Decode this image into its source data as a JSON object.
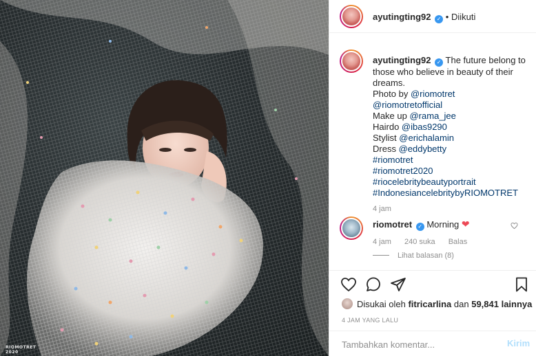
{
  "post": {
    "photo_credit_line1": "RIOMOTRET",
    "photo_credit_line2": "2020"
  },
  "header": {
    "username": "ayutingting92",
    "separator": "•",
    "follow_status": "Diikuti"
  },
  "caption": {
    "username": "ayutingting92",
    "intro": "The future belong to those who believe in beauty of their dreams.",
    "lines": [
      {
        "label": "Photo by ",
        "tag": "@riomotret"
      },
      {
        "label": "",
        "tag": "@riomotretofficial"
      },
      {
        "label": "Make up ",
        "tag": "@rama_jee"
      },
      {
        "label": "Hairdo ",
        "tag": "@ibas9290"
      },
      {
        "label": "Stylist ",
        "tag": "@erichalamin"
      },
      {
        "label": "Dress ",
        "tag": "@eddybetty"
      },
      {
        "label": "",
        "tag": "#riomotret"
      },
      {
        "label": "",
        "tag": "#riomotret2020"
      },
      {
        "label": "",
        "tag": "#riocelebritybeautyportrait"
      },
      {
        "label": "",
        "tag": "#IndonesiancelebritybyRIOMOTRET"
      }
    ],
    "time": "4 jam"
  },
  "comment": {
    "username": "riomotret",
    "text": "Morning",
    "heart": "❤",
    "time": "4 jam",
    "likes": "240 suka",
    "reply": "Balas",
    "view_replies": "Lihat balasan (8)"
  },
  "likes": {
    "prefix": "Disukai oleh ",
    "user": "fitricarlina",
    "middle": " dan ",
    "count": "59,841 lainnya"
  },
  "posted_time": "4 JAM YANG LALU",
  "add_comment": {
    "placeholder": "Tambahkan komentar...",
    "send_label": "Kirim"
  },
  "icons": {
    "verified": "verified-badge-icon",
    "like": "heart-icon",
    "comment": "comment-icon",
    "share": "paper-plane-icon",
    "save": "bookmark-icon"
  },
  "colors": {
    "link": "#00376b",
    "verified": "#3897f0",
    "muted": "#8e8e8e",
    "send_disabled": "#b2dffc",
    "heart": "#ed4956"
  }
}
